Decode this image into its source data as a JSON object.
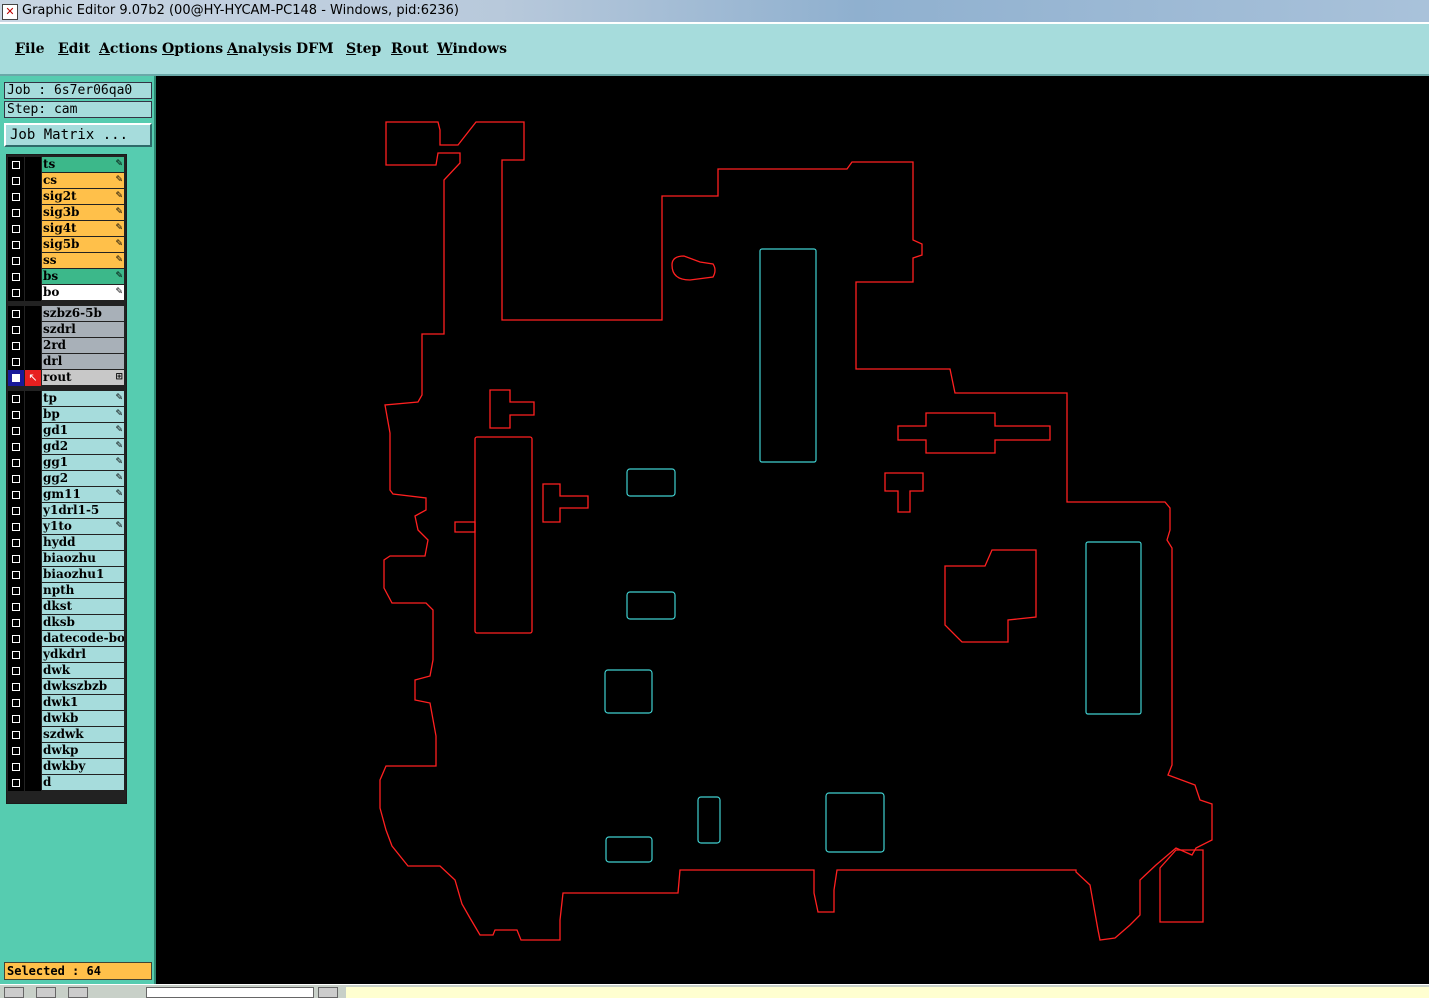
{
  "window": {
    "title": "Graphic Editor 9.07b2 (00@HY-HYCAM-PC148 - Windows, pid:6236)",
    "icon": "x-app-icon"
  },
  "menu": [
    {
      "label": "File",
      "mnemonic_index": 0
    },
    {
      "label": "Edit",
      "mnemonic_index": 0
    },
    {
      "label": "Actions",
      "mnemonic_index": 0
    },
    {
      "label": "Options",
      "mnemonic_index": 0
    },
    {
      "label": "Analysis",
      "mnemonic_index": 0
    },
    {
      "label": "DFM",
      "mnemonic_index": -1
    },
    {
      "label": "Step",
      "mnemonic_index": 0
    },
    {
      "label": "Rout",
      "mnemonic_index": 0
    },
    {
      "label": "Windows",
      "mnemonic_index": 0
    }
  ],
  "job": {
    "label": "Job : 6s7er06qa0",
    "step": "Step: cam",
    "matrix_button": "Job Matrix ..."
  },
  "colors": {
    "signal_green": "#3cb88a",
    "signal_orange": "#ffc04a",
    "white": "#ffffff",
    "drill_gray": "#a8b0b8",
    "doc_cyan": "#a6dcdc",
    "outline_red": "#ff2020",
    "feature_cyan": "#40d0d0"
  },
  "layers": [
    {
      "name": "ts",
      "color": "#3cb88a",
      "icon": "pencil-icon"
    },
    {
      "name": "cs",
      "color": "#ffc04a",
      "icon": "pencil-icon"
    },
    {
      "name": "sig2t",
      "color": "#ffc04a",
      "icon": "pencil-icon"
    },
    {
      "name": "sig3b",
      "color": "#ffc04a",
      "icon": "pencil-icon"
    },
    {
      "name": "sig4t",
      "color": "#ffc04a",
      "icon": "pencil-icon"
    },
    {
      "name": "sig5b",
      "color": "#ffc04a",
      "icon": "pencil-icon"
    },
    {
      "name": "ss",
      "color": "#ffc04a",
      "icon": "pencil-icon"
    },
    {
      "name": "bs",
      "color": "#3cb88a",
      "icon": "pencil-icon"
    },
    {
      "name": "bo",
      "color": "#ffffff",
      "icon": "pencil-icon"
    },
    {
      "name": "szbz6-5b",
      "color": "#a8b0b8",
      "icon": ""
    },
    {
      "name": "szdrl",
      "color": "#a8b0b8",
      "icon": ""
    },
    {
      "name": "2rd",
      "color": "#a8b0b8",
      "icon": ""
    },
    {
      "name": "drl",
      "color": "#a8b0b8",
      "icon": ""
    },
    {
      "name": "rout",
      "color": "#c8c8c8",
      "icon": "grid-icon",
      "displayed": true,
      "affected": true
    },
    {
      "name": "tp",
      "color": "#a6dcdc",
      "icon": "pencil-icon"
    },
    {
      "name": "bp",
      "color": "#a6dcdc",
      "icon": "pencil-icon"
    },
    {
      "name": "gd1",
      "color": "#a6dcdc",
      "icon": "pencil-icon"
    },
    {
      "name": "gd2",
      "color": "#a6dcdc",
      "icon": "pencil-icon"
    },
    {
      "name": "gg1",
      "color": "#a6dcdc",
      "icon": "pencil-icon"
    },
    {
      "name": "gg2",
      "color": "#a6dcdc",
      "icon": "pencil-icon"
    },
    {
      "name": "gm11",
      "color": "#a6dcdc",
      "icon": "pencil-icon"
    },
    {
      "name": "y1drl1-5",
      "color": "#a6dcdc",
      "icon": ""
    },
    {
      "name": "y1to",
      "color": "#a6dcdc",
      "icon": "pencil-icon"
    },
    {
      "name": "hydd",
      "color": "#a6dcdc",
      "icon": ""
    },
    {
      "name": "biaozhu",
      "color": "#a6dcdc",
      "icon": ""
    },
    {
      "name": "biaozhu1",
      "color": "#a6dcdc",
      "icon": ""
    },
    {
      "name": "npth",
      "color": "#a6dcdc",
      "icon": ""
    },
    {
      "name": "dkst",
      "color": "#a6dcdc",
      "icon": ""
    },
    {
      "name": "dksb",
      "color": "#a6dcdc",
      "icon": ""
    },
    {
      "name": "datecode-bo",
      "color": "#a6dcdc",
      "icon": ""
    },
    {
      "name": "ydkdrl",
      "color": "#a6dcdc",
      "icon": ""
    },
    {
      "name": "dwk",
      "color": "#a6dcdc",
      "icon": ""
    },
    {
      "name": "dwkszbzb",
      "color": "#a6dcdc",
      "icon": ""
    },
    {
      "name": "dwk1",
      "color": "#a6dcdc",
      "icon": ""
    },
    {
      "name": "dwkb",
      "color": "#a6dcdc",
      "icon": ""
    },
    {
      "name": "szdwk",
      "color": "#a6dcdc",
      "icon": ""
    },
    {
      "name": "dwkp",
      "color": "#a6dcdc",
      "icon": ""
    },
    {
      "name": "dwkby",
      "color": "#a6dcdc",
      "icon": ""
    },
    {
      "name": "d",
      "color": "#a6dcdc",
      "icon": ""
    }
  ],
  "status": {
    "selected": "Selected : 64"
  }
}
